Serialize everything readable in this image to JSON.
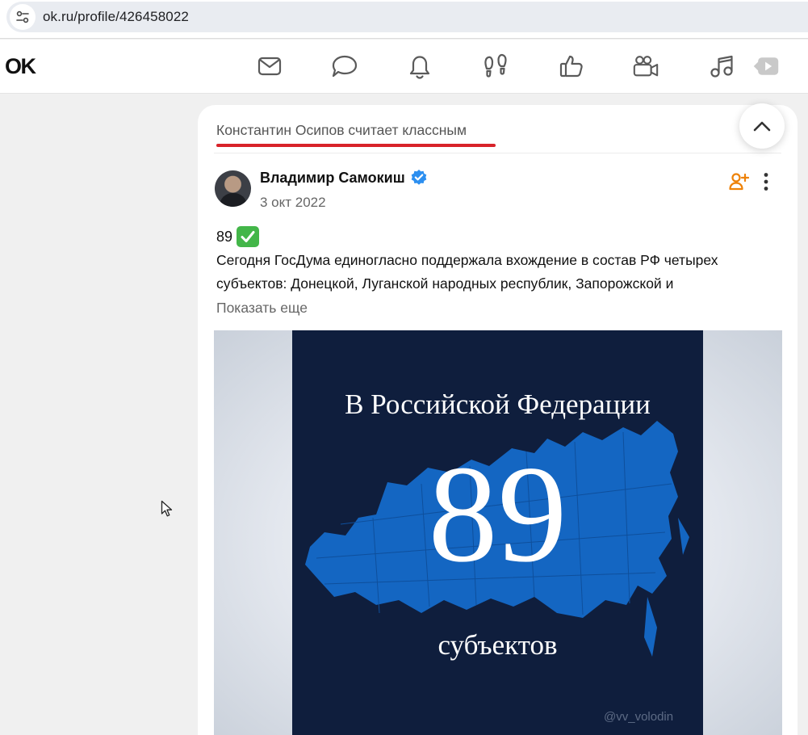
{
  "browser": {
    "url": "ok.ru/profile/426458022",
    "site_icon": "site-settings-icon"
  },
  "header": {
    "logo": "OK",
    "nav_icons": [
      "mail-icon",
      "chat-icon",
      "bell-icon",
      "guests-footprints-icon",
      "like-icon",
      "video-camera-icon",
      "music-icon",
      "video-play-icon"
    ]
  },
  "feed": {
    "activity": "Константин Осипов считает классным",
    "post": {
      "author": "Владимир Самокиш",
      "verified": true,
      "date": "3 окт 2022",
      "number": "89",
      "text": "Сегодня ГосДума единогласно поддержала вхождение в состав РФ четырех субъектов: Донецкой, Луганской народных республик, Запорожской и",
      "show_more": "Показать еще",
      "image": {
        "title": "В Российской Федерации",
        "number": "89",
        "subtitle": "субъектов",
        "watermark": "@vv_volodin"
      }
    }
  },
  "colors": {
    "accent_red": "#d8232a",
    "ok_orange": "#ee8208",
    "verified_blue": "#2c8ff0",
    "poster_bg": "#0f1e3d",
    "map_blue": "#1466c2"
  }
}
